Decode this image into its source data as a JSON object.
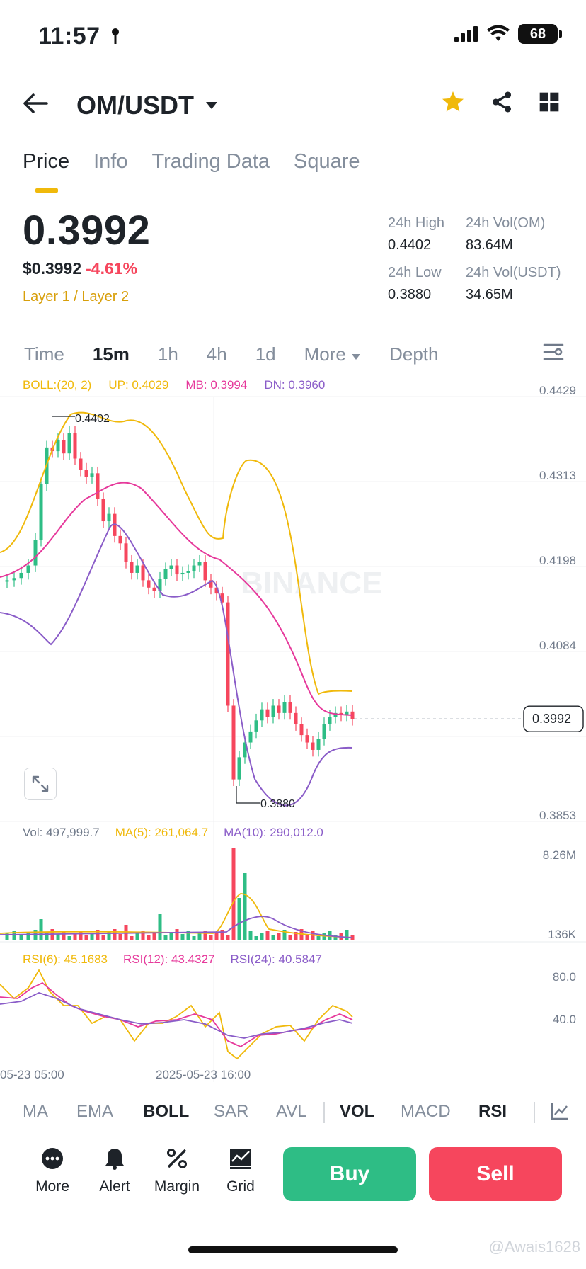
{
  "status_bar": {
    "time": "11:57",
    "battery": "68"
  },
  "header": {
    "pair": "OM/USDT"
  },
  "tabs": [
    "Price",
    "Info",
    "Trading Data",
    "Square"
  ],
  "ticker": {
    "last_price": "0.3992",
    "fiat_price": "$0.3992",
    "change": "-4.61%",
    "tags": "Layer 1 / Layer 2",
    "high_label": "24h High",
    "high": "0.4402",
    "low_label": "24h Low",
    "low": "0.3880",
    "vol_om_label": "24h Vol(OM)",
    "vol_om": "83.64M",
    "vol_usdt_label": "24h Vol(USDT)",
    "vol_usdt": "34.65M"
  },
  "intervals": {
    "time": "Time",
    "m15": "15m",
    "h1": "1h",
    "h4": "4h",
    "d1": "1d",
    "more": "More",
    "depth": "Depth"
  },
  "boll_legend": {
    "boll": "BOLL:(20, 2)",
    "up": "UP: 0.4029",
    "mb": "MB: 0.3994",
    "dn": "DN: 0.3960"
  },
  "price_axis": [
    "0.4429",
    "0.4313",
    "0.4198",
    "0.4084",
    "0.3853"
  ],
  "price_tag": "0.3992",
  "annotations": {
    "high": "0.4402",
    "low": "0.3880"
  },
  "watermark_chart": "BINANCE",
  "vol_legend": {
    "vol": "Vol: 497,999.7",
    "ma5": "MA(5): 261,064.7",
    "ma10": "MA(10): 290,012.0"
  },
  "vol_axis": [
    "8.26M",
    "136K"
  ],
  "rsi_legend": {
    "rsi6": "RSI(6): 45.1683",
    "rsi12": "RSI(12): 43.4327",
    "rsi24": "RSI(24): 40.5847"
  },
  "rsi_axis": [
    "80.0",
    "40.0"
  ],
  "time_axis": [
    "05-23 05:00",
    "2025-05-23 16:00"
  ],
  "indicators": {
    "ma": "MA",
    "ema": "EMA",
    "boll": "BOLL",
    "sar": "SAR",
    "avl": "AVL",
    "vol": "VOL",
    "macd": "MACD",
    "rsi": "RSI"
  },
  "actions": {
    "more": "More",
    "alert": "Alert",
    "margin": "Margin",
    "grid": "Grid",
    "buy": "Buy",
    "sell": "Sell"
  },
  "watermark": "@Awais1628",
  "colors": {
    "up": "#2ebd85",
    "down": "#f6465d",
    "accent": "#f0b90b",
    "boll_up": "#f0b90b",
    "boll_mb": "#e6399b",
    "boll_dn": "#8a5cc8"
  },
  "chart_data": {
    "type": "candlestick",
    "bollinger": {
      "upper": 0.4029,
      "middle": 0.3994,
      "lower": 0.396
    },
    "period_high": 0.4402,
    "period_low": 0.388,
    "last": 0.3992,
    "y_ticks": [
      0.4429,
      0.4313,
      0.4198,
      0.4084,
      0.3853
    ],
    "volume_last": 497999.7,
    "rsi": {
      "rsi6": 45.1683,
      "rsi12": 43.4327,
      "rsi24": 40.5847
    }
  }
}
